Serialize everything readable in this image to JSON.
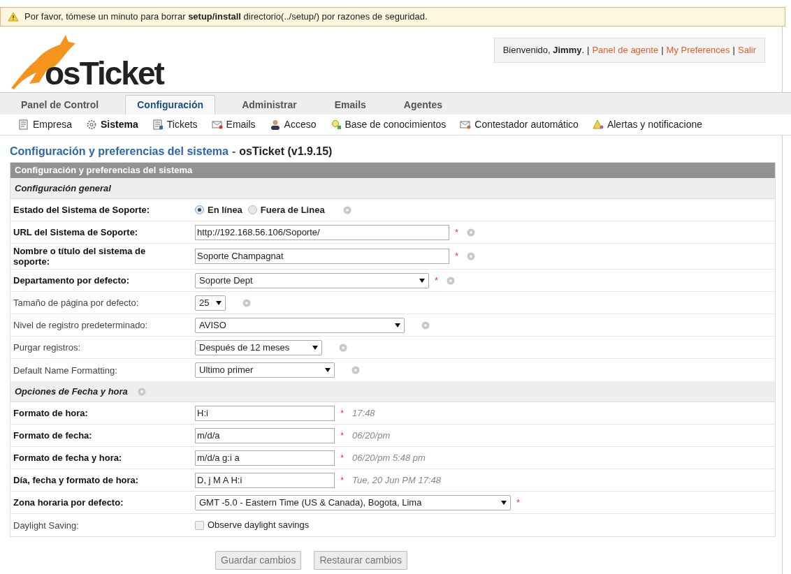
{
  "notice": {
    "text": "Por favor, tómese un minuto para borrar **setup/install** directorio(../setup/) por razones de seguridad."
  },
  "logo": {
    "text": "osTicket"
  },
  "welcome": {
    "greeting": "Bienvenido, **Jimmy**.",
    "separator": "|",
    "links": [
      "Panel de agente",
      "My Preferences",
      "Salir"
    ]
  },
  "tabs": [
    {
      "label": "Panel de Control",
      "selected": false
    },
    {
      "label": "Configuración",
      "selected": true
    },
    {
      "label": "Administrar",
      "selected": false
    },
    {
      "label": "Emails",
      "selected": false
    },
    {
      "label": "Agentes",
      "selected": false
    }
  ],
  "subnav": [
    {
      "label": "Empresa",
      "selected": false
    },
    {
      "label": "Sistema",
      "selected": true
    },
    {
      "label": "Tickets",
      "selected": false
    },
    {
      "label": "Emails",
      "selected": false
    },
    {
      "label": "Acceso",
      "selected": false
    },
    {
      "label": "Base de conocimientos",
      "selected": false
    },
    {
      "label": "Contestador automático",
      "selected": false
    },
    {
      "label": "Alertas y notificacione",
      "selected": false
    }
  ],
  "page_title": {
    "main": "Configuración y preferencias del sistema",
    "separator": "-",
    "product": "osTicket (v1.9.15)"
  },
  "table": {
    "header": "Configuración y preferencias del sistema",
    "sections": [
      {
        "title": "Configuración general",
        "help": false,
        "rows": [
          {
            "kind": "radio",
            "label": "Estado del Sistema de Soporte:",
            "bold": true,
            "required": false,
            "help": true,
            "options": [
              {
                "label": "En línea",
                "selected": true
              },
              {
                "label": "Fuera de Linea",
                "selected": false
              }
            ]
          },
          {
            "kind": "text",
            "label": "URL del Sistema de Soporte:",
            "bold": true,
            "required": true,
            "help": true,
            "value": "http://192.168.56.106/Soporte/"
          },
          {
            "kind": "text",
            "label": "Nombre o título del sistema de soporte:",
            "bold": true,
            "required": true,
            "help": true,
            "value": "Soporte Champagnat"
          },
          {
            "kind": "select",
            "label": "Departamento por defecto:",
            "bold": true,
            "required": true,
            "help": true,
            "value": "Soporte Dept"
          },
          {
            "kind": "select",
            "label": "Tamaño de página por defecto:",
            "bold": false,
            "required": false,
            "help": true,
            "value": "25"
          },
          {
            "kind": "select",
            "label": "Nivel de registro predeterminado:",
            "bold": false,
            "required": false,
            "help": true,
            "value": "AVISO"
          },
          {
            "kind": "select",
            "label": "Purgar registros:",
            "bold": false,
            "required": false,
            "help": true,
            "value": "Después de 12 meses"
          },
          {
            "kind": "select",
            "label": "Default Name Formatting:",
            "bold": false,
            "required": false,
            "help": true,
            "value": "Ultimo primer"
          }
        ]
      },
      {
        "title": "Opciones de Fecha y hora",
        "help": true,
        "rows": [
          {
            "kind": "text",
            "label": "Formato de hora:",
            "bold": true,
            "required": true,
            "help": false,
            "value": "H:i",
            "hint": "17:48"
          },
          {
            "kind": "text",
            "label": "Formato de fecha:",
            "bold": true,
            "required": true,
            "help": false,
            "value": "m/d/a",
            "hint": "06/20/pm"
          },
          {
            "kind": "text",
            "label": "Formato de fecha y hora:",
            "bold": true,
            "required": true,
            "help": false,
            "value": "m/d/a g:i a",
            "hint": "06/20/pm 5:48 pm"
          },
          {
            "kind": "text",
            "label": "Día, fecha y formato de hora:",
            "bold": true,
            "required": true,
            "help": false,
            "value": "D, j M A H:i",
            "hint": "Tue, 20 Jun PM 17:48"
          },
          {
            "kind": "select",
            "label": "Zona horaria por defecto:",
            "bold": true,
            "required": true,
            "help": false,
            "value": "GMT -5.0 - Eastern Time (US & Canada), Bogota, Lima"
          },
          {
            "kind": "checkbox",
            "label": "Daylight Saving:",
            "bold": false,
            "required": false,
            "help": false,
            "checked": false,
            "text": "Observe daylight savings"
          }
        ]
      }
    ]
  },
  "required_mark": "*",
  "buttons": [
    "Guardar cambios",
    "Restaurar cambios"
  ]
}
